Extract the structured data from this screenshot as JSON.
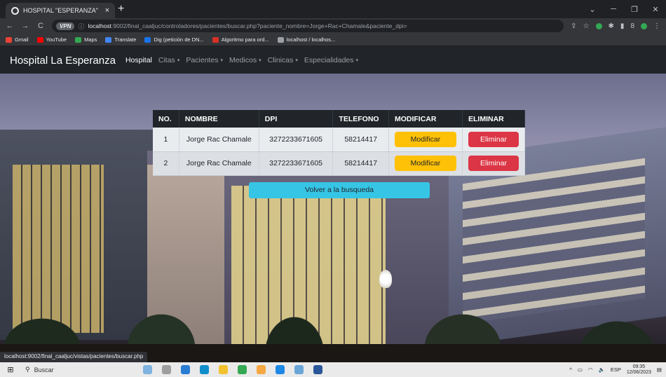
{
  "browser": {
    "tab_title": "HOSPITAL \"ESPERANZA\"",
    "tab_close": "×",
    "new_tab": "+",
    "omnibox_badge": "VPN",
    "url_host": "localhost",
    "url_rest": ":9002/final_caaljuc/controladores/pacientes/buscar.php?paciente_nombre=Jorge+Rac+Chamale&paciente_dpi=",
    "bookmarks": [
      {
        "label": "Gmail",
        "color": "#ea4335"
      },
      {
        "label": "YouTube",
        "color": "#ff0000"
      },
      {
        "label": "Maps",
        "color": "#34a853"
      },
      {
        "label": "Translate",
        "color": "#4285f4"
      },
      {
        "label": "Dig (petición de DN...",
        "color": "#1a73e8"
      },
      {
        "label": "Algoritmo para ord...",
        "color": "#d93025"
      },
      {
        "label": "localhost / localhos...",
        "color": "#9aa0a6"
      }
    ],
    "status_url": "localhost:9002/final_caaljuc/vistas/pacientes/buscar.php"
  },
  "navbar": {
    "brand": "Hospital La Esperanza",
    "items": [
      {
        "label": "Hospital",
        "dropdown": false,
        "active": true
      },
      {
        "label": "Citas",
        "dropdown": true,
        "active": false
      },
      {
        "label": "Pacientes",
        "dropdown": true,
        "active": false
      },
      {
        "label": "Medicos",
        "dropdown": true,
        "active": false
      },
      {
        "label": "Clinicas",
        "dropdown": true,
        "active": false
      },
      {
        "label": "Especialidades",
        "dropdown": true,
        "active": false
      }
    ],
    "caret": "▾"
  },
  "table": {
    "headers": [
      "NO.",
      "NOMBRE",
      "DPI",
      "TELEFONO",
      "MODIFICAR",
      "ELIMINAR"
    ],
    "rows": [
      {
        "no": "1",
        "nombre": "Jorge Rac Chamale",
        "dpi": "3272233671605",
        "telefono": "58214417",
        "modificar": "Modificar",
        "eliminar": "Eliminar"
      },
      {
        "no": "2",
        "nombre": "Jorge Rac Chamale",
        "dpi": "3272233671605",
        "telefono": "58214417",
        "modificar": "Modificar",
        "eliminar": "Eliminar"
      }
    ]
  },
  "volver_button": "Volver a la busqueda",
  "taskbar": {
    "search_placeholder": "Buscar",
    "language": "ESP",
    "time": "09:35",
    "date": "12/06/2023"
  },
  "colors": {
    "navbar": "#212529",
    "warning": "#ffc107",
    "danger": "#dc3545",
    "info": "#36c5e5"
  }
}
